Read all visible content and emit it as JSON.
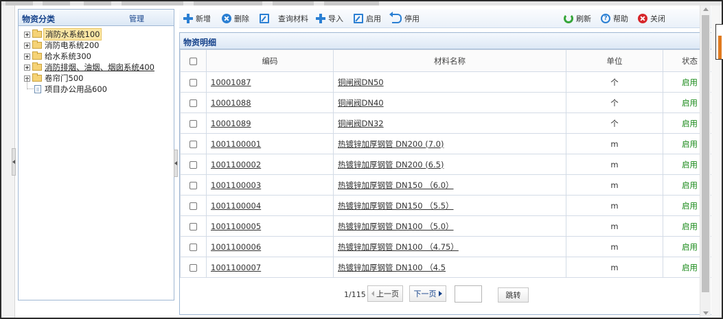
{
  "left_panel": {
    "title": "物资分类",
    "manage_label": "管理",
    "tree": [
      {
        "label": "消防水系统100",
        "selected": true,
        "underline": false,
        "type": "folder"
      },
      {
        "label": "消防电系统200",
        "selected": false,
        "underline": false,
        "type": "folder"
      },
      {
        "label": "给水系统300",
        "selected": false,
        "underline": false,
        "type": "folder"
      },
      {
        "label": "消防排烟、油烟、烟囱系统400",
        "selected": false,
        "underline": true,
        "type": "folder"
      },
      {
        "label": "卷帘门500",
        "selected": false,
        "underline": false,
        "type": "folder"
      },
      {
        "label": "项目办公用品600",
        "selected": false,
        "underline": false,
        "type": "doc"
      }
    ]
  },
  "toolbar": {
    "add": "新增",
    "delete": "删除",
    "query": "查询材料",
    "import": "导入",
    "enable": "启用",
    "disable": "停用",
    "refresh": "刷新",
    "help": "帮助",
    "close": "关闭"
  },
  "grid": {
    "title": "物资明细",
    "columns": {
      "code": "编码",
      "name": "材料名称",
      "unit": "单位",
      "status": "状态"
    },
    "rows": [
      {
        "code": "10001087",
        "name": "铜闸阀DN50",
        "unit": "个",
        "status": "启用"
      },
      {
        "code": "10001088",
        "name": "铜闸阀DN40",
        "unit": "个",
        "status": "启用"
      },
      {
        "code": "10001089",
        "name": "铜闸阀DN32",
        "unit": "个",
        "status": "启用"
      },
      {
        "code": "1001100001",
        "name": "热镀锌加厚钢管 DN200 (7.0)",
        "unit": "m",
        "status": "启用"
      },
      {
        "code": "1001100002",
        "name": "热镀锌加厚钢管 DN200 (6.5)",
        "unit": "m",
        "status": "启用"
      },
      {
        "code": "1001100003",
        "name": "热镀锌加厚钢管 DN150 （6.0）",
        "unit": "m",
        "status": "启用"
      },
      {
        "code": "1001100004",
        "name": "热镀锌加厚钢管 DN150 （5.5）",
        "unit": "m",
        "status": "启用"
      },
      {
        "code": "1001100005",
        "name": "热镀锌加厚钢管 DN100 （5.0）",
        "unit": "m",
        "status": "启用"
      },
      {
        "code": "1001100006",
        "name": "热镀锌加厚钢管 DN100 （4.75）",
        "unit": "m",
        "status": "启用"
      },
      {
        "code": "1001100007",
        "name": "热镀锌加厚钢管 DN100 （4.5",
        "unit": "m",
        "status": "启用"
      }
    ]
  },
  "pager": {
    "info": "1/115",
    "prev": "上一页",
    "next": "下一页",
    "page_input": "",
    "go": "跳转"
  },
  "colors": {
    "accent": "#15428b",
    "status_enabled": "#1a8a1a",
    "icon_blue": "#2a7fd3",
    "refresh_green": "#36a63a",
    "close_red": "#d6262b"
  },
  "icons": [
    "plus-icon",
    "delete-icon",
    "edit-icon",
    "undo-icon",
    "refresh-icon",
    "help-icon",
    "close-icon",
    "folder-icon",
    "document-icon",
    "expand-icon"
  ]
}
